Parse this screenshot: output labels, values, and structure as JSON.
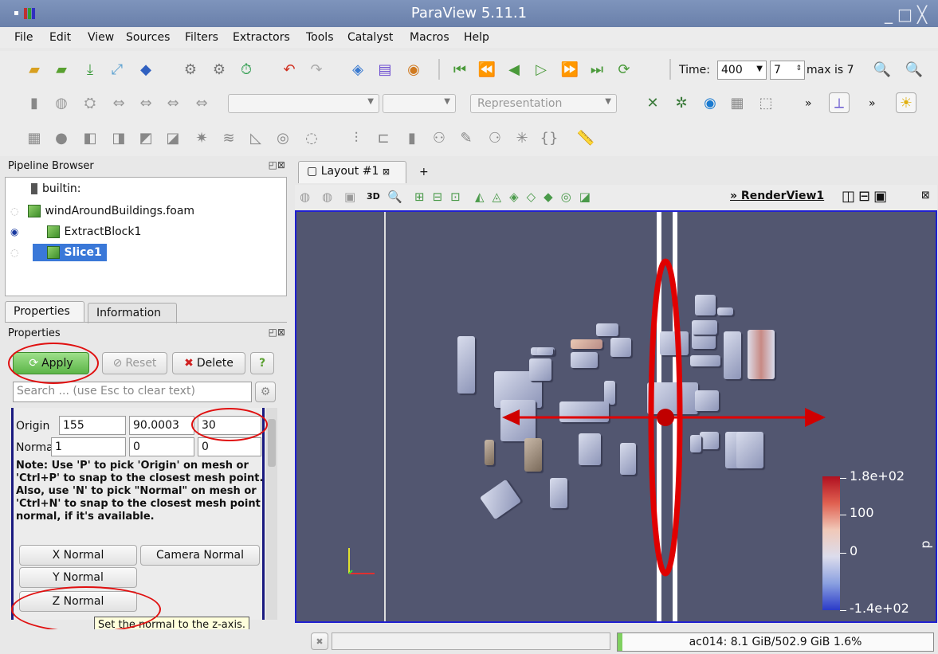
{
  "window": {
    "title": "ParaView 5.11.1",
    "min": "_",
    "max": "□",
    "close": "╳"
  },
  "menu": [
    "File",
    "Edit",
    "View",
    "Sources",
    "Filters",
    "Extractors",
    "Tools",
    "Catalyst",
    "Macros",
    "Help"
  ],
  "time": {
    "label": "Time:",
    "value": "400",
    "step": "7",
    "max_label": "max is 7"
  },
  "representation": {
    "placeholder": "Representation"
  },
  "pipeline": {
    "title": "Pipeline Browser",
    "items": [
      "builtin:",
      "windAroundBuildings.foam",
      "ExtractBlock1",
      "Slice1"
    ]
  },
  "tabs": {
    "properties": "Properties",
    "information": "Information"
  },
  "properties": {
    "title": "Properties",
    "apply": "Apply",
    "reset": "Reset",
    "delete": "Delete",
    "help": "?",
    "search_placeholder": "Search ... (use Esc to clear text)",
    "origin_label": "Origin",
    "origin": [
      "155",
      "90.0003",
      "30"
    ],
    "normal_label": "Normal",
    "normal": [
      "1",
      "0",
      "0"
    ],
    "note": "Note: Use 'P' to pick 'Origin' on mesh or 'Ctrl+P' to snap to the closest mesh point. Also, use 'N' to pick \"Normal\" on mesh or 'Ctrl+N' to snap to the closest mesh point normal, if it's available.",
    "x_normal": "X Normal",
    "camera_normal": "Camera Normal",
    "y_normal": "Y Normal",
    "z_normal": "Z Normal",
    "tooltip": "Set the normal to the z-axis."
  },
  "layout": {
    "tab": "Layout #1",
    "add": "+",
    "view_name": "RenderView1",
    "btn_3d": "3D"
  },
  "colorbar": {
    "labels": [
      "1.8e+02",
      "100",
      "0",
      "-1.4e+02"
    ],
    "title": "p"
  },
  "status": {
    "memory": "ac014: 8.1 GiB/502.9 GiB 1.6%"
  }
}
